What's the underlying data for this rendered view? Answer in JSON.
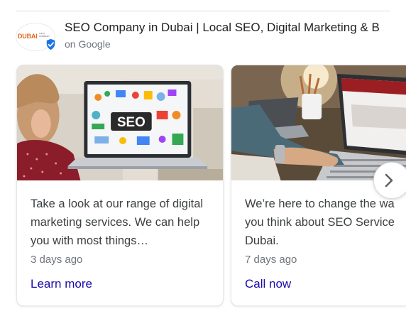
{
  "business": {
    "name": "SEO Company in Dubai | Local SEO, Digital Marketing & B",
    "source": "on Google",
    "logo_text": "DUBAI",
    "logo_subtext": "S E O COMPANY"
  },
  "posts": [
    {
      "image": "seo-laptop-photo",
      "text": "Take a look at our range of digital marketing services. We can help you with most things…",
      "date": "3 days ago",
      "action": "Learn more"
    },
    {
      "image": "typing-laptop-photo",
      "text_lines": [
        "We’re here to change the wa",
        "you think about SEO Service",
        "Dubai."
      ],
      "date": "7 days ago",
      "action": "Call now"
    }
  ],
  "colors": {
    "link": "#1a0dab",
    "verified_badge": "#1a73e8",
    "logo_orange": "#e06a1b"
  },
  "icons": {
    "verified": "verified-check-icon",
    "next": "chevron-right-icon"
  }
}
